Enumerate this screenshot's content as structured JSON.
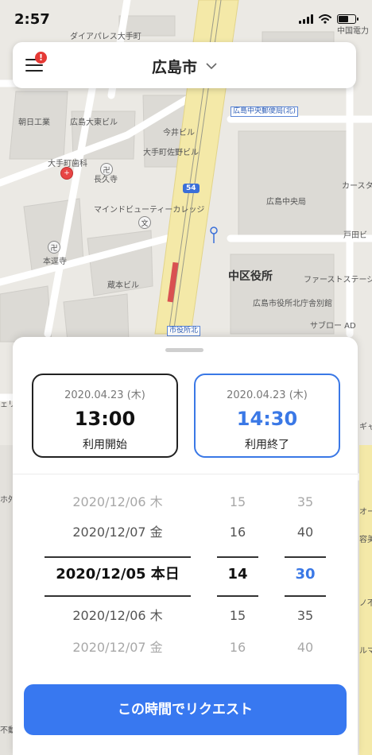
{
  "status_bar": {
    "time": "2:57"
  },
  "header": {
    "city": "広島市",
    "notification_badge": "!"
  },
  "map": {
    "labels": [
      "ダイアパレス大手町",
      "中国電力",
      "朝日工業",
      "広島大東ビル",
      "今井ビル",
      "大手町佐野ビル",
      "大手町歯科",
      "長久寺",
      "カースタ",
      "広島中央局",
      "マインドビューティーカレッジ",
      "戸田ビ",
      "本逕寺",
      "中区役所",
      "ファーストステージ国",
      "蔵本ビル",
      "広島市役所北庁舎別館",
      "サブロー AD",
      "ギャラ",
      "オー",
      "容美",
      "ルマ",
      "ェリ",
      "ホ外科",
      "ノ不",
      "不動"
    ],
    "stop_labels": [
      "広島中央郵便局(北)",
      "市役所北"
    ],
    "route_number": "54",
    "poi_glyphs": {
      "temple": "卍",
      "school": "文",
      "hospital": "+"
    }
  },
  "sheet": {
    "start": {
      "date": "2020.04.23 (木)",
      "time": "13:00",
      "label": "利用開始"
    },
    "end": {
      "date": "2020.04.23 (木)",
      "time": "14:30",
      "label": "利用終了"
    },
    "picker": {
      "dates": [
        "2020/12/06 木",
        "2020/12/07 金",
        "2020/12/05 本日",
        "2020/12/06 木",
        "2020/12/07 金"
      ],
      "hours": [
        "15",
        "16",
        "14",
        "15",
        "16"
      ],
      "minutes": [
        "35",
        "40",
        "30",
        "35",
        "40"
      ]
    },
    "request_button": "この時間でリクエスト"
  },
  "colors": {
    "accent": "#3878f0",
    "end_card_border": "#3a78e6",
    "badge": "#e53935",
    "road_yellow": "#f4e9a8"
  }
}
